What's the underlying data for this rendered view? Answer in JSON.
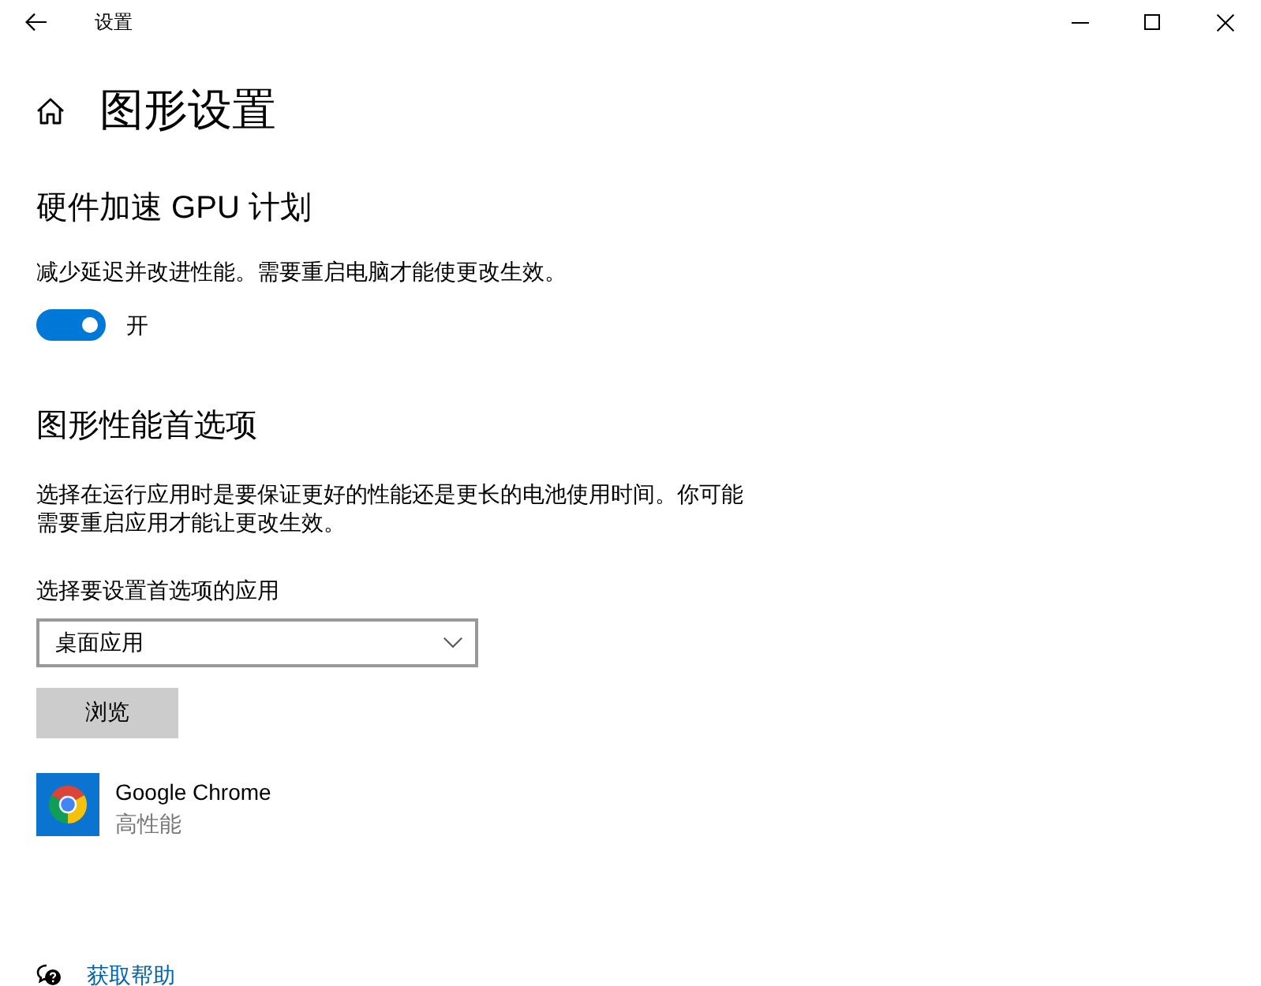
{
  "window": {
    "title": "设置"
  },
  "page": {
    "title": "图形设置"
  },
  "gpu_scheduling": {
    "heading": "硬件加速 GPU 计划",
    "description": "减少延迟并改进性能。需要重启电脑才能使更改生效。",
    "toggle": {
      "on": true,
      "label": "开"
    }
  },
  "graphics_preference": {
    "heading": "图形性能首选项",
    "description": "选择在运行应用时是要保证更好的性能还是更长的电池使用时间。你可能需要重启应用才能让更改生效。",
    "app_type_label": "选择要设置首选项的应用",
    "app_type_dropdown": {
      "value": "桌面应用"
    },
    "browse_button": "浏览",
    "apps": [
      {
        "name": "Google Chrome",
        "preference": "高性能"
      }
    ]
  },
  "help_link": "获取帮助"
}
